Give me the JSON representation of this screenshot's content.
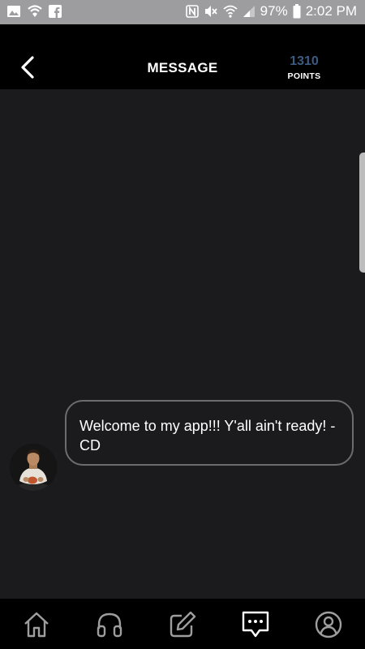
{
  "status_bar": {
    "battery": "97%",
    "time": "2:02 PM",
    "icons_left": [
      "image-icon",
      "shield-wifi-icon",
      "facebook-icon"
    ],
    "icons_right": [
      "nfc-icon",
      "mute-icon",
      "wifi-icon",
      "signal-icon",
      "battery-icon"
    ]
  },
  "header": {
    "title": "MESSAGE",
    "points_value": "1310",
    "points_label": "POINTS",
    "back_icon": "chevron-left-icon"
  },
  "colors": {
    "background": "#1b1b1d",
    "header": "#000000",
    "points": "#3d5a80",
    "bubble_border": "#6c6c6e"
  },
  "messages": [
    {
      "text": "Welcome to my app!!! Y'all ain't ready! -CD",
      "avatar": "user-avatar"
    }
  ],
  "nav": {
    "items": [
      {
        "icon": "home-icon",
        "active": false
      },
      {
        "icon": "headphones-icon",
        "active": false
      },
      {
        "icon": "edit-icon",
        "active": false
      },
      {
        "icon": "message-icon",
        "active": true
      },
      {
        "icon": "profile-icon",
        "active": false
      }
    ]
  }
}
